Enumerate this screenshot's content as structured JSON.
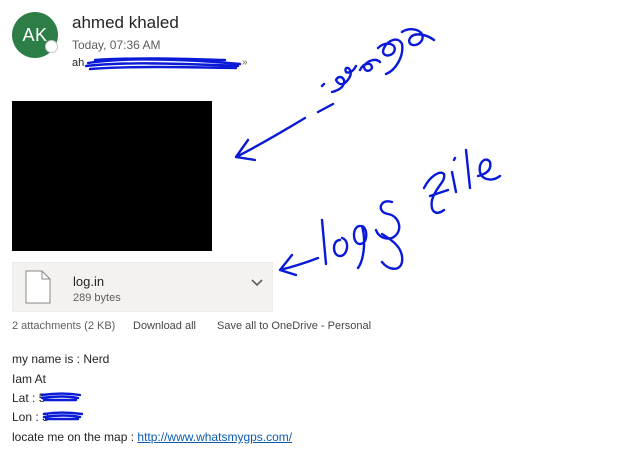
{
  "email": {
    "sender_initials": "AK",
    "sender_name": "ahmed khaled",
    "timestamp": "Today, 07:36 AM",
    "recipient_visible_prefix": "ah"
  },
  "attachments": {
    "file": {
      "name": "log.in",
      "size": "289 bytes",
      "icon": "document-icon"
    },
    "summary": "2 attachments (2 KB)",
    "download_all": "Download all",
    "save_all": "Save all to OneDrive - Personal"
  },
  "body": {
    "line1": "my name is : Nerd",
    "line2": "Iam At",
    "lat_label": "Lat : ",
    "lat_visible": "5",
    "lon_label": "Lon : ",
    "lon_visible": "3",
    "line5_prefix": "locate me on the map : ",
    "link": "http://www.whatsmygps.com/"
  },
  "annotations": {
    "image_label": "image",
    "log_label": "logs file",
    "ink_color": "#0a1ad6"
  }
}
